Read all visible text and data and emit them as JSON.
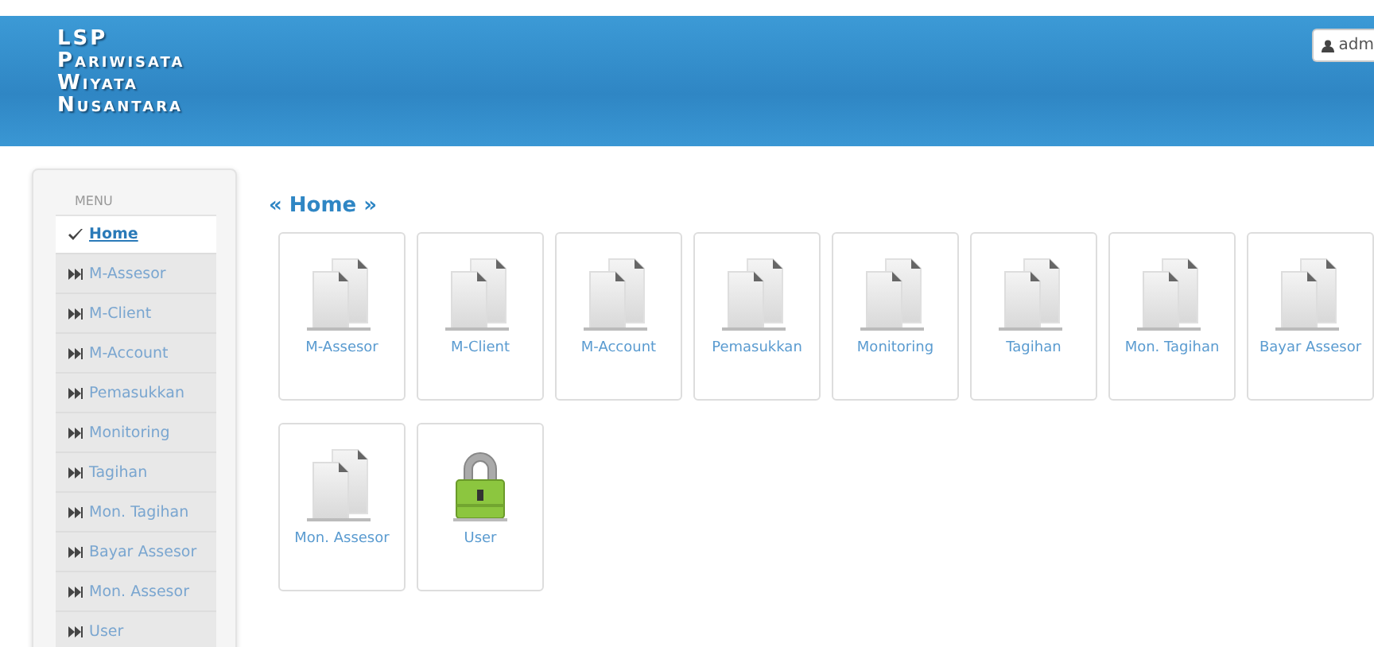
{
  "header": {
    "brand_lines": [
      "LSP",
      "Pariwisata",
      "Wiyata",
      "Nusantara"
    ],
    "user_button": "adm"
  },
  "sidebar": {
    "heading": "MENU",
    "items": [
      {
        "label": "Home",
        "selected": true
      },
      {
        "label": "M-Assesor",
        "selected": false
      },
      {
        "label": "M-Client",
        "selected": false
      },
      {
        "label": "M-Account",
        "selected": false
      },
      {
        "label": "Pemasukkan",
        "selected": false
      },
      {
        "label": "Monitoring",
        "selected": false
      },
      {
        "label": "Tagihan",
        "selected": false
      },
      {
        "label": "Mon. Tagihan",
        "selected": false
      },
      {
        "label": "Bayar Assesor",
        "selected": false
      },
      {
        "label": "Mon. Assesor",
        "selected": false
      },
      {
        "label": "User",
        "selected": false
      }
    ]
  },
  "content": {
    "title": "« Home »",
    "tiles": [
      {
        "label": "M-Assesor",
        "kind": "document"
      },
      {
        "label": "M-Client",
        "kind": "document"
      },
      {
        "label": "M-Account",
        "kind": "document"
      },
      {
        "label": "Pemasukkan",
        "kind": "document"
      },
      {
        "label": "Monitoring",
        "kind": "document"
      },
      {
        "label": "Tagihan",
        "kind": "document"
      },
      {
        "label": "Mon. Tagihan",
        "kind": "document"
      },
      {
        "label": "Bayar Assesor",
        "kind": "document"
      },
      {
        "label": "Mon. Assesor",
        "kind": "document"
      },
      {
        "label": "User",
        "kind": "lock"
      }
    ]
  }
}
